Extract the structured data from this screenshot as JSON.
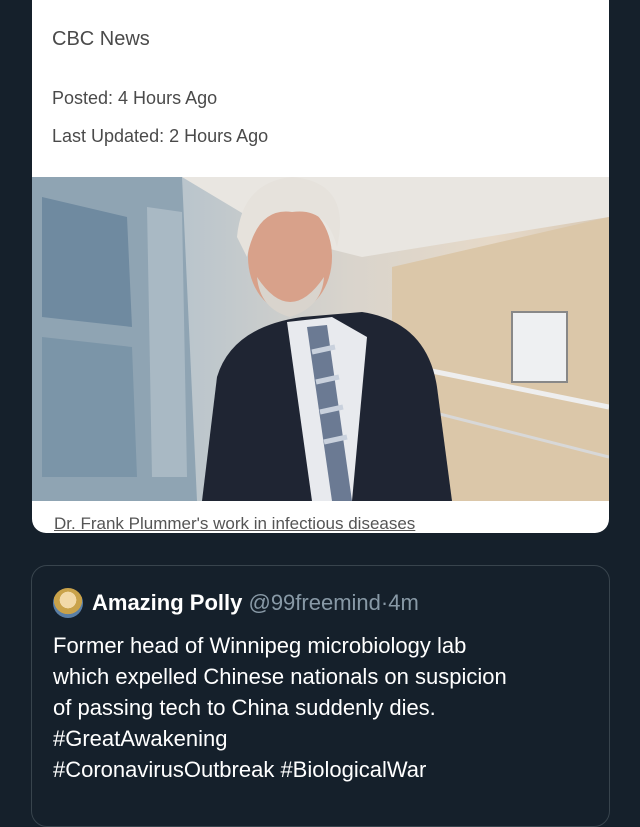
{
  "article": {
    "source": "CBC News",
    "posted": "Posted: 4 Hours Ago",
    "updated": "Last Updated: 2 Hours Ago",
    "caption": "Dr. Frank Plummer's work in infectious diseases"
  },
  "tweet": {
    "name": "Amazing Polly",
    "handle": "@99freemind",
    "separator": "·",
    "time": "4m",
    "text_lines": [
      "Former head of Winnipeg microbiology lab",
      "which expelled Chinese nationals on suspicion",
      "of passing tech to China suddenly dies.",
      "#GreatAwakening",
      "#CoronavirusOutbreak #BiologicalWar"
    ]
  },
  "colors": {
    "background": "#15202b",
    "card": "#ffffff",
    "handle": "#8899a6"
  }
}
